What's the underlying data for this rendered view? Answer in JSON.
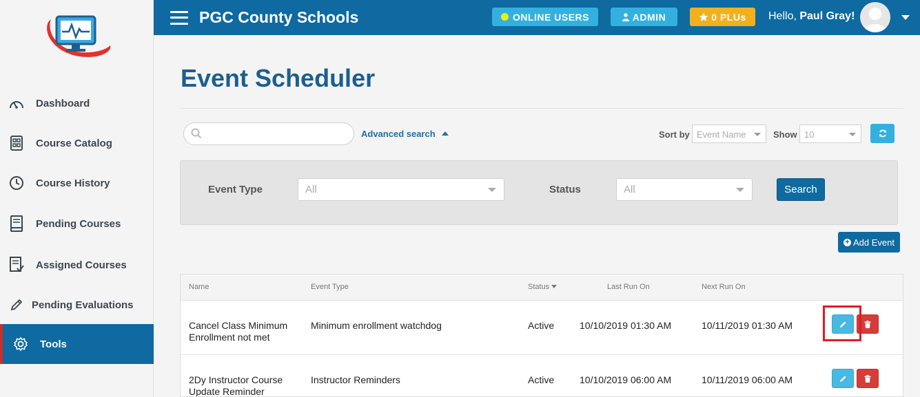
{
  "header": {
    "app_title": "PGC County Schools",
    "online_users_label": "ONLINE USERS",
    "admin_label": "ADMIN",
    "plus_label": "0 PLUs",
    "greeting": "Hello,",
    "user_name": "Paul Gray!"
  },
  "sidebar": {
    "items": [
      {
        "label": "Dashboard",
        "icon": "gauge-icon",
        "active": false
      },
      {
        "label": "Course Catalog",
        "icon": "catalog-icon",
        "active": false
      },
      {
        "label": "Course History",
        "icon": "clock-icon",
        "active": false
      },
      {
        "label": "Pending Courses",
        "icon": "book-icon",
        "active": false
      },
      {
        "label": "Assigned Courses",
        "icon": "checklist-icon",
        "active": false
      },
      {
        "label": "Pending Evaluations",
        "icon": "pencil-icon",
        "active": false
      },
      {
        "label": "Tools",
        "icon": "gear-icon",
        "active": true
      }
    ]
  },
  "main": {
    "page_title": "Event Scheduler",
    "search_placeholder": "",
    "advanced_search_label": "Advanced search",
    "sort_by_label": "Sort by",
    "sort_by_value": "Event Name",
    "show_label": "Show",
    "show_value": "10",
    "filters": {
      "event_type_label": "Event Type",
      "event_type_value": "All",
      "status_label": "Status",
      "status_value": "All",
      "search_button": "Search"
    },
    "add_event_label": "Add Event"
  },
  "table": {
    "columns": [
      "Name",
      "Event Type",
      "Status",
      "Last Run On",
      "Next Run On"
    ],
    "rows": [
      {
        "name": "Cancel Class Minimum Enrollment not met",
        "event_type": "Minimum enrollment watchdog",
        "status": "Active",
        "last_run": "10/10/2019 01:30 AM",
        "next_run": "10/11/2019 01:30 AM"
      },
      {
        "name": "2Dy Instructor Course Update Reminder",
        "event_type": "Instructor Reminders",
        "status": "Active",
        "last_run": "10/10/2019 06:00 AM",
        "next_run": "10/11/2019 06:00 AM"
      }
    ]
  },
  "colors": {
    "brand_blue": "#0e6aa0",
    "accent_cyan": "#34b0df",
    "plu_yellow": "#f2b01c",
    "delete_red": "#d43d3a",
    "highlight_red": "#e01b24"
  }
}
